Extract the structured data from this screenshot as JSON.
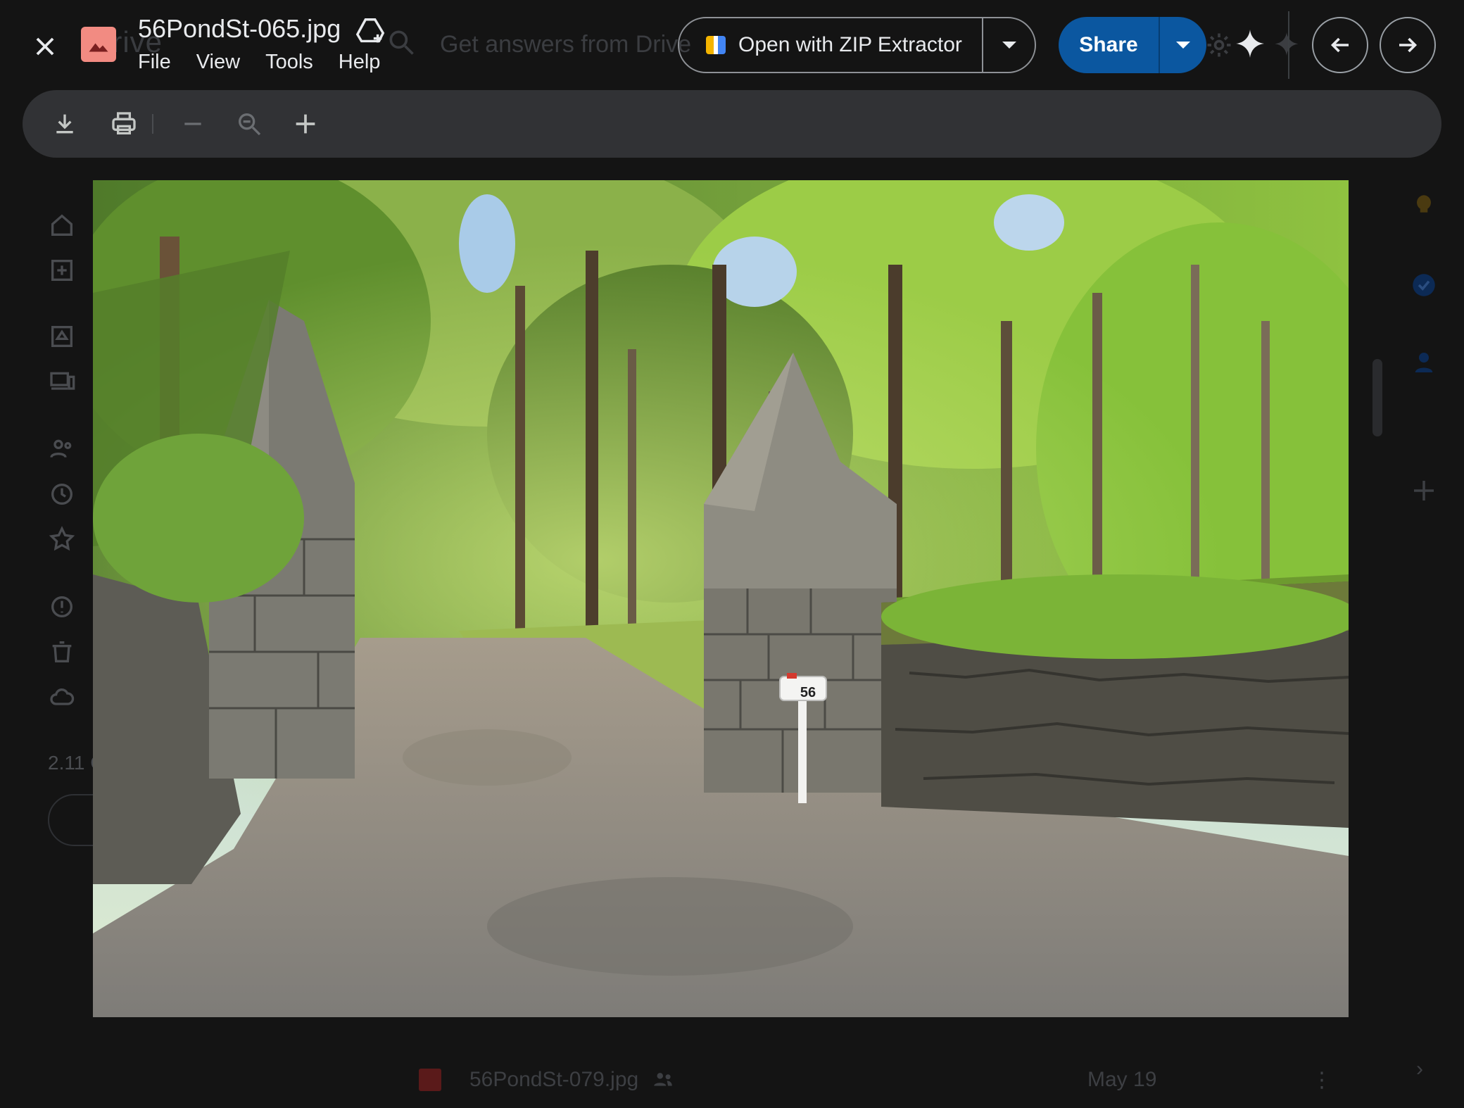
{
  "viewer": {
    "file_name": "56PondSt-065.jpg",
    "menu": [
      "File",
      "View",
      "Tools",
      "Help"
    ],
    "open_with_label": "Open with ZIP Extractor",
    "share_label": "Share"
  },
  "background": {
    "app_word": "Drive",
    "ask_placeholder": "Get answers from Drive",
    "storage_text": "2.11 G",
    "file_row": {
      "name": "56PondSt-079.jpg",
      "date": "May 19",
      "more": "⋮"
    }
  },
  "photo": {
    "mailbox_number": "56"
  },
  "icons": {
    "close": "close-icon",
    "file_type": "image-file-icon",
    "add_to_drive": "add-to-drive-icon",
    "download": "download-icon",
    "print": "print-icon",
    "zoom_out": "zoom-out-icon",
    "zoom_reset": "zoom-icon",
    "zoom_in": "zoom-in-icon",
    "previous": "arrow-left-icon",
    "next": "arrow-right-icon",
    "gemini": "gemini-sparkle-icon"
  },
  "colors": {
    "share_button": "#0b57a0",
    "toolbar": "#313235",
    "background": "#141414",
    "file_icon": "#f28b82"
  }
}
